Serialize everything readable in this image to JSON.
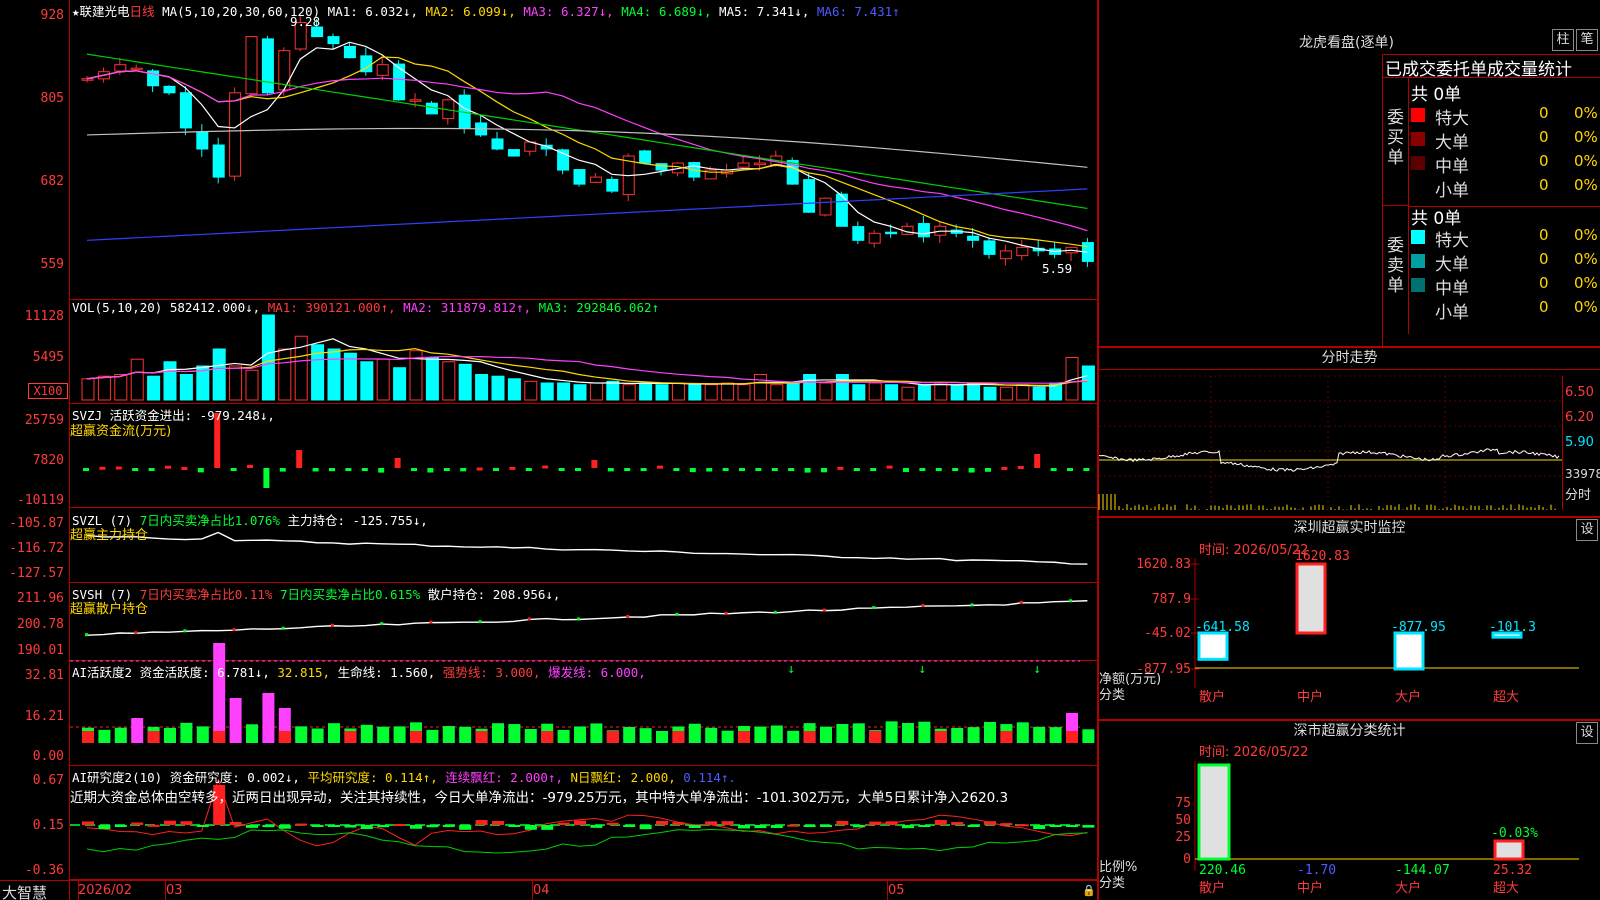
{
  "stock": {
    "name": "联建光电",
    "period": "日线"
  },
  "ma_header": {
    "label": "MA(5,10,20,30,60,120)",
    "ma1": "MA1: 6.032↓,",
    "ma2": "MA2: 6.099↓,",
    "ma3": "MA3: 6.327↓,",
    "ma4": "MA4: 6.689↓,",
    "ma5": "MA5: 7.341↓,",
    "ma6": "MA6: 7.431↑"
  },
  "price_axis": [
    "928",
    "805",
    "682",
    "559"
  ],
  "price_labels": {
    "high": "9.28",
    "low": "5.59"
  },
  "vol_header": {
    "label": "VOL(5,10,20)",
    "val": "582412.000↓,",
    "ma1": "MA1: 390121.000↑,",
    "ma2": "MA2: 311879.812↑,",
    "ma3": "MA3: 292846.062↑"
  },
  "vol_axis": [
    "11128",
    "5495",
    "X100"
  ],
  "svzj": {
    "header": "SVZJ  活跃资金进出: -979.248↓,",
    "title": "超赢资金流(万元)",
    "axis": [
      "25759",
      "7820",
      "-10119"
    ]
  },
  "svzl": {
    "header1": "SVZL (7)",
    "header2": "7日内买卖净占比1.076%",
    "header3": "主力持仓: -125.755↓,",
    "title": "超赢主力持仓",
    "axis": [
      "-105.87",
      "-116.72",
      "-127.57"
    ]
  },
  "svsh": {
    "header1": "SVSH (7)",
    "header2": "7日内买卖净占比0.11%",
    "header3": "7日内买卖净占比0.615%",
    "header4": "散户持仓: 208.956↓,",
    "title": "超赢散户持仓",
    "axis": [
      "211.96",
      "200.78",
      "190.01"
    ]
  },
  "ai1": {
    "h1": "AI活跃度2",
    "h2": "资金活跃度: 6.781↓,",
    "h3": "32.815,",
    "h4": "生命线: 1.560,",
    "h5": "强势线: 3.000,",
    "h6": "爆发线: 6.000,",
    "axis": [
      "32.81",
      "16.21",
      "0.00"
    ]
  },
  "ai2": {
    "h1": "AI研究度2(10)",
    "h2": "资金研究度: 0.002↓,",
    "h3": "平均研究度: 0.114↑,",
    "h4": "连续飘红: 2.000↑,",
    "h5": "N日飘红: 2.000,",
    "h6": "0.114↑.",
    "commentary": "近期大资金总体由空转多，近两日出现异动，关注其持续性，今日大单净流出：-979.25万元，其中特大单净流出：-101.302万元，大单5日累计净入2620.3",
    "axis": [
      "0.67",
      "0.15",
      "-0.36"
    ]
  },
  "date_axis": {
    "brand": "大智慧",
    "labels": [
      "2026/02",
      "03",
      "04",
      "05"
    ]
  },
  "lhkp": {
    "title": "龙虎看盘(逐单)",
    "btn1": "柱",
    "btn2": "笔",
    "subtitle": "已成交委托单成交量统计",
    "buy_total": "共 0单",
    "sell_total": "共 0单",
    "buy_label": [
      "委",
      "买",
      "单"
    ],
    "sell_label": [
      "委",
      "卖",
      "单"
    ],
    "buy_rows": [
      {
        "name": "特大",
        "n": "0",
        "p": "0%",
        "color": "#ff0000"
      },
      {
        "name": "大单",
        "n": "0",
        "p": "0%",
        "color": "#8a0000"
      },
      {
        "name": "中单",
        "n": "0",
        "p": "0%",
        "color": "#5a0000"
      },
      {
        "name": "小单",
        "n": "0",
        "p": "0%",
        "color": "#000000"
      }
    ],
    "sell_rows": [
      {
        "name": "特大",
        "n": "0",
        "p": "0%",
        "color": "#00ffff"
      },
      {
        "name": "大单",
        "n": "0",
        "p": "0%",
        "color": "#00a0a0"
      },
      {
        "name": "中单",
        "n": "0",
        "p": "0%",
        "color": "#007070"
      },
      {
        "name": "小单",
        "n": "0",
        "p": "0%",
        "color": "#000000"
      }
    ]
  },
  "fenshi": {
    "title": "分时走势",
    "axis": [
      "6.50",
      "6.20",
      "5.90",
      "33978"
    ],
    "vol_label": "分时"
  },
  "szjk": {
    "title": "深圳超赢实时监控",
    "btn": "设",
    "time": "时间: 2026/05/22",
    "axis": [
      "1620.83",
      "787.9",
      "-45.02",
      "-877.95"
    ],
    "ylabel": "净额(万元)",
    "xlabel": "分类",
    "cats": [
      "散户",
      "中户",
      "大户",
      "超大"
    ],
    "vals": [
      "-641.58",
      "1620.83",
      "-877.95",
      "-101.3"
    ],
    "values": [
      -641.58,
      1620.83,
      -877.95,
      -101.3
    ]
  },
  "sscy": {
    "title": "深市超赢分类统计",
    "btn": "设",
    "time": "时间: 2026/05/22",
    "axis": [
      "75",
      "50",
      "25",
      "0"
    ],
    "ylabel": "比例%",
    "xlabel": "分类",
    "cats": [
      "散户",
      "中户",
      "大户",
      "超大"
    ],
    "vals": [
      "220.46",
      "-1.70",
      "-144.07",
      "25.32"
    ],
    "extra": "-0.03%"
  }
}
